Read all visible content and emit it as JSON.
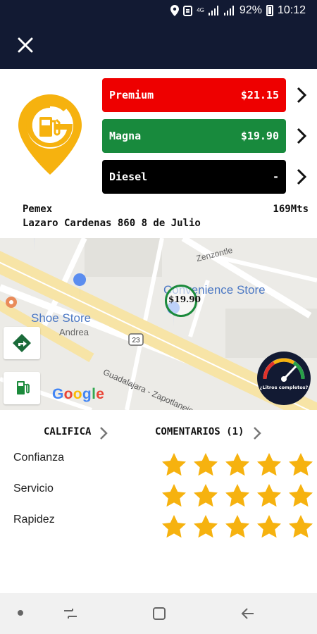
{
  "status_bar": {
    "battery": "92%",
    "time": "10:12",
    "network": "4G"
  },
  "app_bar": {
    "close_icon": "close-icon"
  },
  "station": {
    "brand": "Pemex",
    "address": "Lazaro Cardenas 860 8 de Julio",
    "distance": "169Mts"
  },
  "prices": [
    {
      "name": "Premium",
      "price": "$21.15",
      "color": "#ee0000"
    },
    {
      "name": "Magna",
      "price": "$19.90",
      "color": "#188a3d"
    },
    {
      "name": "Diesel",
      "price": "-",
      "color": "#000000"
    }
  ],
  "map": {
    "labels": {
      "shoe_store": "Shoe Store",
      "andrea": "Andrea",
      "convenience": "Convenience Store",
      "zenzontle": "Zenzontle",
      "avenue": "Guadalajara - Zapotlanejo",
      "highway_shield": "23"
    },
    "marker_price": "$19.90",
    "google_logo": "Google",
    "gauge_text": "¿Litros completos?"
  },
  "ratings": {
    "tab_califica": "CALIFICA",
    "tab_comentarios": "COMENTARIOS (1)",
    "rows": [
      {
        "label": "Confianza",
        "stars": 5
      },
      {
        "label": "Servicio",
        "stars": 5
      },
      {
        "label": "Rapidez",
        "stars": 5
      }
    ],
    "star_color": "#f6b20f"
  },
  "colors": {
    "header": "#121a33",
    "brand_yellow": "#f6b20f"
  }
}
